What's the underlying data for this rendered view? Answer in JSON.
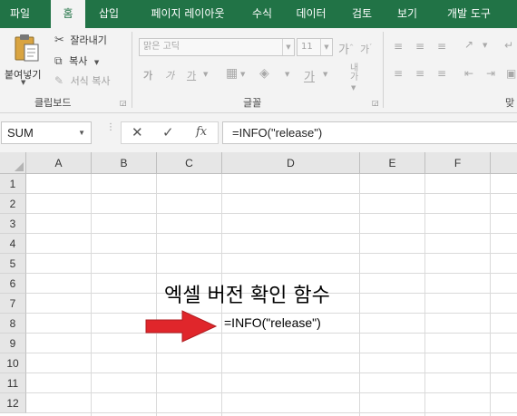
{
  "menu": {
    "tabs": [
      "파일",
      "홈",
      "삽입",
      "페이지 레이아웃",
      "수식",
      "데이터",
      "검토",
      "보기",
      "개발 도구"
    ],
    "active_index": 1
  },
  "ribbon": {
    "clipboard": {
      "paste_label": "붙여넣기",
      "cut_label": "잘라내기",
      "copy_label": "복사",
      "format_painter_label": "서식 복사",
      "group_label": "클립보드"
    },
    "font": {
      "font_name": "맑은 고딕",
      "font_size": "11",
      "group_label": "글꼴"
    },
    "alignment": {
      "group_label_partial": "맞"
    }
  },
  "formula_bar": {
    "name_box": "SUM",
    "cancel_symbol": "✕",
    "enter_symbol": "✓",
    "fx_symbol": "fx",
    "formula": "=INFO(\"release\")"
  },
  "sheet": {
    "columns": [
      "A",
      "B",
      "C",
      "D",
      "E",
      "F"
    ],
    "rows": [
      "1",
      "2",
      "3",
      "4",
      "5",
      "6",
      "7",
      "8",
      "9",
      "10",
      "11",
      "12"
    ],
    "title_text": "엑셀 버전 확인 함수",
    "cell_D8": "=INFO(\"release\")"
  },
  "colors": {
    "brand": "#217346",
    "arrow": "#e0262b"
  }
}
